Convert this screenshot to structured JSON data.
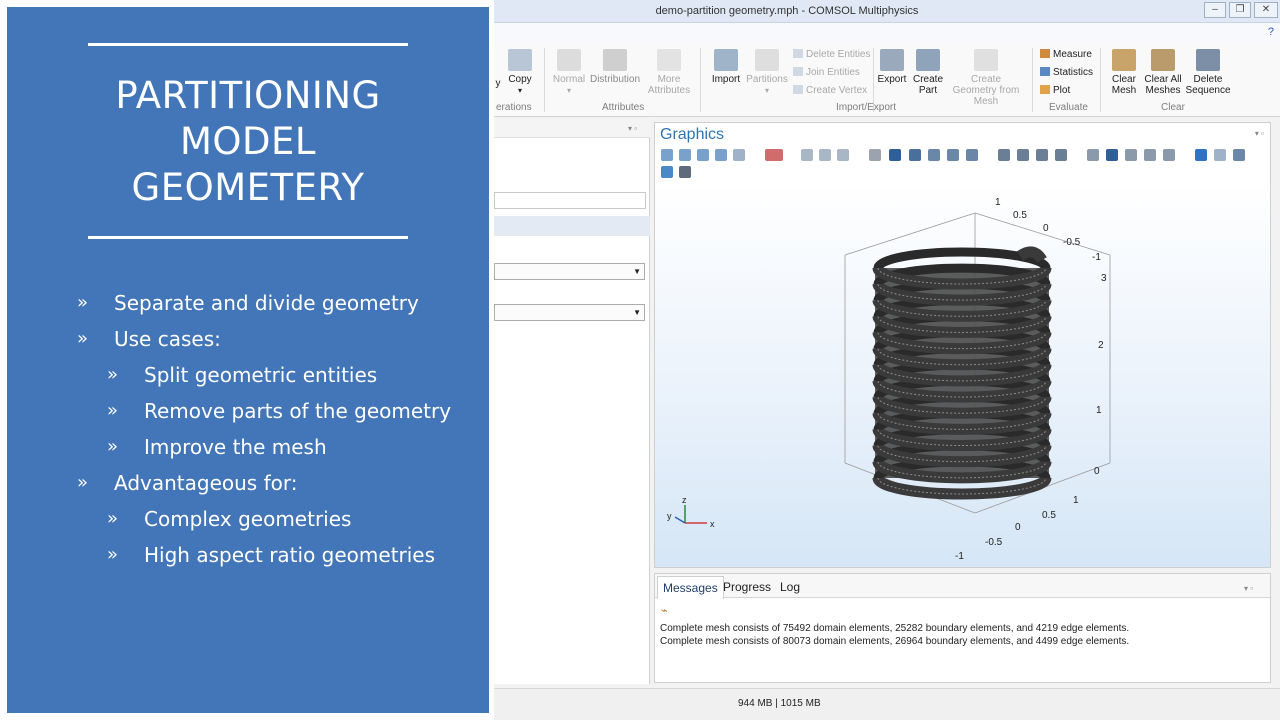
{
  "slide": {
    "title_lines": [
      "PARTITIONING",
      "MODEL",
      "GEOMETERY"
    ],
    "bullets": [
      {
        "text": "Separate and divide geometry",
        "level": 1
      },
      {
        "text": "Use cases:",
        "level": 1
      },
      {
        "text": "Split geometric entities",
        "level": 2
      },
      {
        "text": "Remove parts of the geometry",
        "level": 2
      },
      {
        "text": "Improve the mesh",
        "level": 2
      },
      {
        "text": "Advantageous for:",
        "level": 1
      },
      {
        "text": "Complex geometries",
        "level": 2
      },
      {
        "text": "High aspect ratio geometries",
        "level": 2
      }
    ],
    "bullet_marker": "»",
    "colors": {
      "panel": "#4276b8",
      "text": "#ffffff"
    }
  },
  "app": {
    "window_title": "demo-partition geometry.mph - COMSOL Multiphysics",
    "help_label": "?",
    "ribbon": {
      "operations": {
        "partial_label": "y",
        "copy": "Copy",
        "group_partial": "erations"
      },
      "attributes": {
        "normal": "Normal",
        "distribution": "Distribution",
        "more_attributes": "More Attributes",
        "group": "Attributes"
      },
      "import_export": {
        "import": "Import",
        "partitions": "Partitions",
        "delete_entities": "Delete Entities",
        "join_entities": "Join Entities",
        "create_vertex": "Create Vertex",
        "export": "Export",
        "create_part": "Create Part",
        "create_geometry_from_mesh": "Create Geometry from Mesh",
        "group": "Import/Export"
      },
      "evaluate": {
        "measure": "Measure",
        "statistics": "Statistics",
        "plot": "Plot",
        "group": "Evaluate"
      },
      "clear": {
        "clear_mesh": "Clear Mesh",
        "clear_all_meshes": "Clear All Meshes",
        "delete_sequence": "Delete Sequence",
        "group": "Clear"
      }
    },
    "graphics": {
      "title": "Graphics",
      "axis_numbers": {
        "top": [
          "1",
          "0.5",
          "0",
          "-0.5",
          "-1"
        ],
        "z": [
          "3",
          "2",
          "1",
          "0"
        ],
        "bottom_right": [
          "1",
          "0.5",
          "0",
          "-0.5",
          "-1"
        ]
      },
      "triad": {
        "x": "x",
        "y": "y",
        "z": "z"
      }
    },
    "messages": {
      "tabs": [
        "Messages",
        "Progress",
        "Log"
      ],
      "lines": [
        "Complete mesh consists of 75492 domain elements, 25282 boundary elements, and 4219 edge elements.",
        "Complete mesh consists of 80073 domain elements, 26964 boundary elements, and 4499 edge elements."
      ]
    },
    "status": {
      "memory": "944 MB | 1015 MB"
    },
    "colors": {
      "accent": "#2e74b5",
      "coil": "#3a3a3a"
    }
  }
}
